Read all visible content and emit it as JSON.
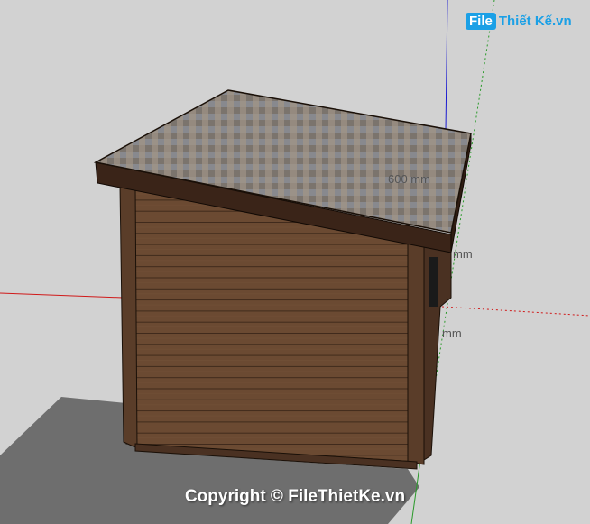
{
  "logo": {
    "badge": "File",
    "rest": "Thiết Kế.vn",
    "color": "#1ba0e6"
  },
  "dimensions": {
    "label_1": "600 mm",
    "label_2": "mm",
    "label_3": "mm"
  },
  "copyright": "Copyright © FileThietKe.vn",
  "colors": {
    "background": "#d2d2d2",
    "shadow": "#6e6e6e",
    "wall": "#6b4a32",
    "roof_edge": "#3a2418",
    "roof_top": "#8a8278",
    "axis_blue": "#1a1ad0",
    "axis_red": "#d01a1a",
    "axis_green": "#2a9a2a"
  }
}
